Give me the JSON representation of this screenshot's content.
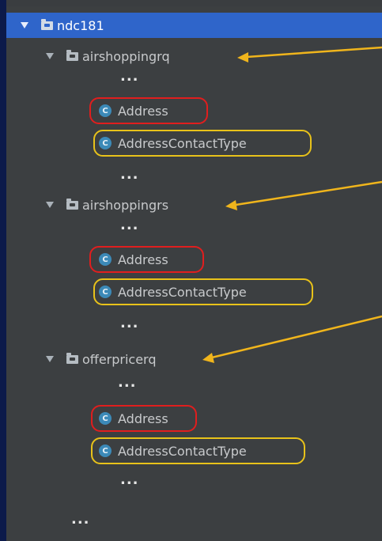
{
  "tree": {
    "root": {
      "label": "ndc181",
      "icon": "folder-icon",
      "expanded": true,
      "selected": true
    },
    "packages": [
      {
        "label": "airshoppingrq",
        "items": [
          {
            "label": "Address",
            "highlight": "red"
          },
          {
            "label": "AddressContactType",
            "highlight": "yellow"
          }
        ]
      },
      {
        "label": "airshoppingrs",
        "items": [
          {
            "label": "Address",
            "highlight": "red"
          },
          {
            "label": "AddressContactType",
            "highlight": "yellow"
          }
        ]
      },
      {
        "label": "offerpricerq",
        "items": [
          {
            "label": "Address",
            "highlight": "red"
          },
          {
            "label": "AddressContactType",
            "highlight": "yellow"
          }
        ]
      }
    ],
    "ellipsis": "...",
    "class_icon_letter": "C"
  },
  "colors": {
    "panel_bg": "#3c3f41",
    "selection": "#2f65ca",
    "class_icon": "#3c8ab8",
    "highlight_red": "#e01e1e",
    "highlight_yellow": "#e8c21a",
    "arrow_annotation": "#f0b51c",
    "outer_background": "#0c1a4a"
  }
}
